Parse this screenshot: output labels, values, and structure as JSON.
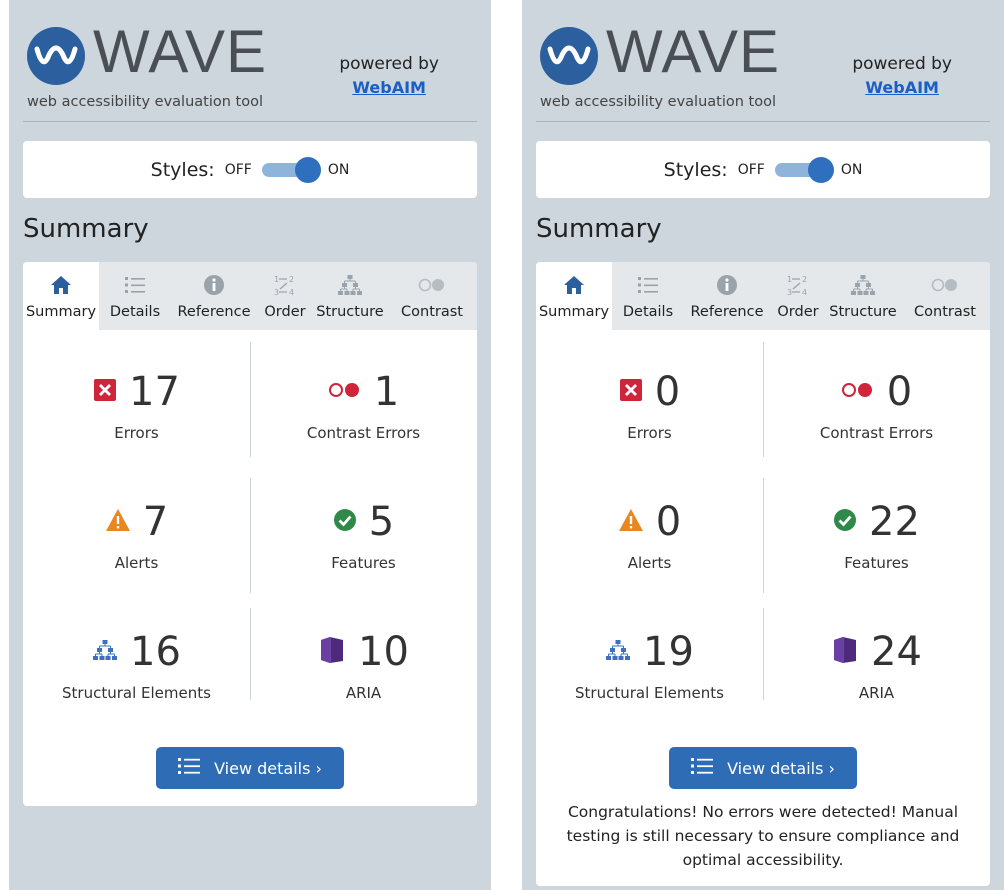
{
  "colors": {
    "panel_bg": "#cdd6dd",
    "brand_blue": "#2c5f9e",
    "button_blue": "#2e6db6",
    "error_red": "#d0243a",
    "alert_orange": "#e8871e",
    "feature_green": "#2f8a4a",
    "aria_purple": "#4e2a7d",
    "structure_blue": "#3f6fbf"
  },
  "panels": [
    {
      "brand": {
        "name": "WAVE",
        "tagline": "web accessibility evaluation tool",
        "powered_by": "powered by",
        "webaim_link": "WebAIM"
      },
      "styles": {
        "label": "Styles:",
        "off": "OFF",
        "on": "ON",
        "state": "on"
      },
      "heading": "Summary",
      "tabs": [
        "Summary",
        "Details",
        "Reference",
        "Order",
        "Structure",
        "Contrast"
      ],
      "active_tab": "Summary",
      "stats": {
        "errors": {
          "count": "17",
          "label": "Errors",
          "icon": "error-icon"
        },
        "contrast_errors": {
          "count": "1",
          "label": "Contrast Errors",
          "icon": "contrast-icon"
        },
        "alerts": {
          "count": "7",
          "label": "Alerts",
          "icon": "alert-icon"
        },
        "features": {
          "count": "5",
          "label": "Features",
          "icon": "feature-icon"
        },
        "structural": {
          "count": "16",
          "label": "Structural Elements",
          "icon": "structure-icon"
        },
        "aria": {
          "count": "10",
          "label": "ARIA",
          "icon": "aria-icon"
        }
      },
      "view_details": "View details ›",
      "message": ""
    },
    {
      "brand": {
        "name": "WAVE",
        "tagline": "web accessibility evaluation tool",
        "powered_by": "powered by",
        "webaim_link": "WebAIM"
      },
      "styles": {
        "label": "Styles:",
        "off": "OFF",
        "on": "ON",
        "state": "on"
      },
      "heading": "Summary",
      "tabs": [
        "Summary",
        "Details",
        "Reference",
        "Order",
        "Structure",
        "Contrast"
      ],
      "active_tab": "Summary",
      "stats": {
        "errors": {
          "count": "0",
          "label": "Errors",
          "icon": "error-icon"
        },
        "contrast_errors": {
          "count": "0",
          "label": "Contrast Errors",
          "icon": "contrast-icon"
        },
        "alerts": {
          "count": "0",
          "label": "Alerts",
          "icon": "alert-icon"
        },
        "features": {
          "count": "22",
          "label": "Features",
          "icon": "feature-icon"
        },
        "structural": {
          "count": "19",
          "label": "Structural Elements",
          "icon": "structure-icon"
        },
        "aria": {
          "count": "24",
          "label": "ARIA",
          "icon": "aria-icon"
        }
      },
      "view_details": "View details ›",
      "message": "Congratulations! No errors were detected! Manual testing is still necessary to ensure compliance and optimal accessibility."
    }
  ]
}
